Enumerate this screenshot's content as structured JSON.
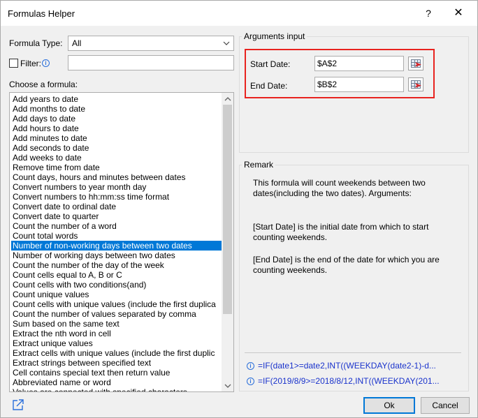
{
  "window": {
    "title": "Formulas Helper",
    "help": "?",
    "close": "✕"
  },
  "left": {
    "formula_type_label": "Formula Type:",
    "formula_type_value": "All",
    "filter_label": "Filter:",
    "choose_label": "Choose a formula:",
    "selected_index": 15,
    "formulas": [
      "Add years to date",
      "Add months to date",
      "Add days to date",
      "Add hours to date",
      "Add minutes to date",
      "Add seconds to date",
      "Add weeks to date",
      "Remove time from date",
      "Count days, hours and minutes between dates",
      "Convert numbers to year month day",
      "Convert numbers to hh:mm:ss time format",
      "Convert date to ordinal date",
      "Convert date to quarter",
      "Count the number of a word",
      "Count total words",
      "Number of non-working days between two dates",
      "Number of working days between two dates",
      "Count the number of the day of the week",
      "Count cells equal to A, B or C",
      "Count cells with two conditions(and)",
      "Count unique values",
      "Count cells with unique values (include the first duplica",
      "Count the number of values separated by comma",
      "Sum based on the same text",
      "Extract the nth word in cell",
      "Extract unique values",
      "Extract cells with unique values (include the first duplic",
      "Extract strings between specified text",
      "Cell contains special text then return value",
      "Abbreviated name or word",
      "Values are connected with specified characters"
    ]
  },
  "arguments": {
    "group_title": "Arguments input",
    "start_label": "Start Date:",
    "start_value": "$A$2",
    "end_label": "End Date:",
    "end_value": "$B$2"
  },
  "remark": {
    "group_title": "Remark",
    "para1_line1": "This formula will count weekends between two",
    "para1_line2": "dates(including the two dates). Arguments:",
    "para2_line1": "[Start Date] is the initial date from which to start",
    "para2_line2": "counting weekends.",
    "para3_line1": "[End Date] is the end of the date for which you are",
    "para3_line2": "counting weekends.",
    "formula1": "=IF(date1>=date2,INT((WEEKDAY(date2-1)-d...",
    "formula2": "=IF(2019/8/9>=2018/8/12,INT((WEEKDAY(201..."
  },
  "buttons": {
    "ok": "Ok",
    "cancel": "Cancel"
  },
  "colors": {
    "selection": "#0078d7",
    "highlight_border": "#e8231f",
    "formula_text": "#1a33cc"
  }
}
